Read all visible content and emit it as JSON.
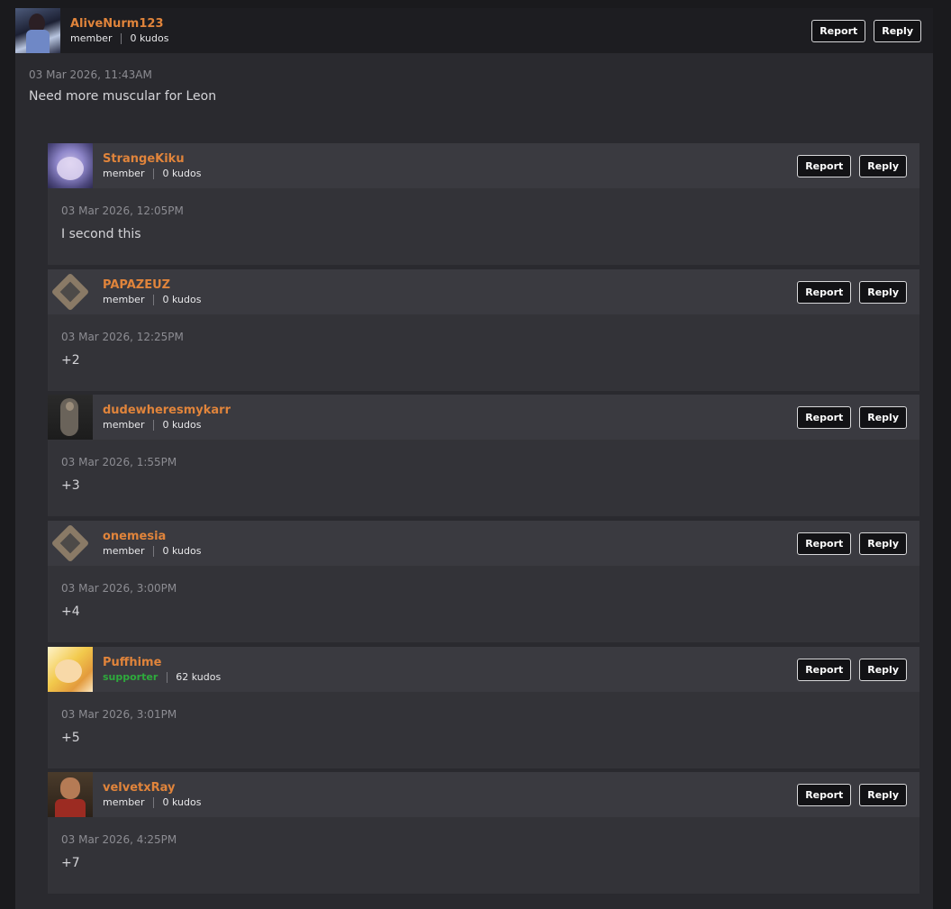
{
  "top_comment": {
    "username": "AliveNurm123",
    "role": "member",
    "kudos": "0 kudos",
    "timestamp": "03 Mar 2026, 11:43AM",
    "text": "Need more muscular for Leon",
    "report_label": "Report",
    "reply_label": "Reply",
    "avatar_icon": "user-avatar"
  },
  "replies": [
    {
      "username": "StrangeKiku",
      "role": "member",
      "kudos": "0 kudos",
      "timestamp": "03 Mar 2026, 12:05PM",
      "text": "I second this",
      "report_label": "Report",
      "reply_label": "Reply"
    },
    {
      "username": "PAPAZEUZ",
      "role": "member",
      "kudos": "0 kudos",
      "timestamp": "03 Mar 2026, 12:25PM",
      "text": "+2",
      "report_label": "Report",
      "reply_label": "Reply"
    },
    {
      "username": "dudewheresmykarr",
      "role": "member",
      "kudos": "0 kudos",
      "timestamp": "03 Mar 2026, 1:55PM",
      "text": "+3",
      "report_label": "Report",
      "reply_label": "Reply"
    },
    {
      "username": "onemesia",
      "role": "member",
      "kudos": "0 kudos",
      "timestamp": "03 Mar 2026, 3:00PM",
      "text": "+4",
      "report_label": "Report",
      "reply_label": "Reply"
    },
    {
      "username": "Puffhime",
      "role": "supporter",
      "kudos": "62 kudos",
      "timestamp": "03 Mar 2026, 3:01PM",
      "text": "+5",
      "report_label": "Report",
      "reply_label": "Reply"
    },
    {
      "username": "velvetxRay",
      "role": "member",
      "kudos": "0 kudos",
      "timestamp": "03 Mar 2026, 4:25PM",
      "text": "+7",
      "report_label": "Report",
      "reply_label": "Reply"
    }
  ],
  "colors": {
    "username": "#e0843b",
    "supporter": "#2eaa3c",
    "background": "#1a1a1d",
    "panel": "#2a2a2f",
    "reply_panel": "#333338",
    "reply_header": "#3a3a40"
  }
}
